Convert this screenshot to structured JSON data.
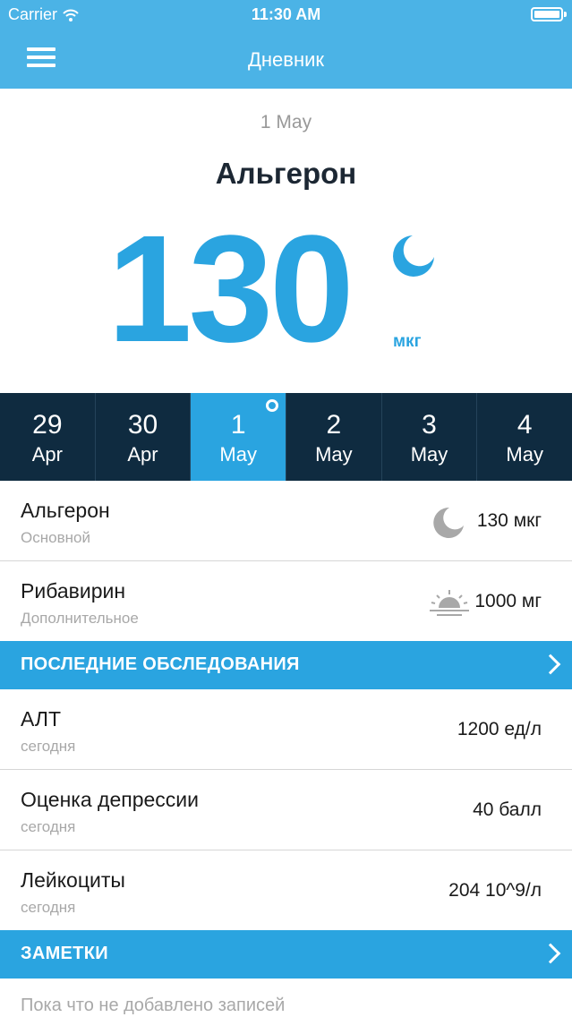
{
  "status": {
    "carrier": "Carrier",
    "time": "11:30 AM"
  },
  "header": {
    "title": "Дневник"
  },
  "summary": {
    "date": "1 May",
    "drug": "Альгерон",
    "dose": "130",
    "unit": "мкг"
  },
  "days": [
    {
      "num": "29",
      "mon": "Apr"
    },
    {
      "num": "30",
      "mon": "Apr"
    },
    {
      "num": "1",
      "mon": "May"
    },
    {
      "num": "2",
      "mon": "May"
    },
    {
      "num": "3",
      "mon": "May"
    },
    {
      "num": "4",
      "mon": "May"
    }
  ],
  "meds": [
    {
      "name": "Альгерон",
      "type": "Основной",
      "value": "130 мкг",
      "icon": "moon-icon"
    },
    {
      "name": "Рибавирин",
      "type": "Дополнительное",
      "value": "1000 мг",
      "icon": "sunrise-icon"
    }
  ],
  "exams": {
    "title": "ПОСЛЕДНИЕ ОБСЛЕДОВАНИЯ",
    "items": [
      {
        "name": "АЛТ",
        "when": "сегодня",
        "value": "1200 ед/л"
      },
      {
        "name": "Оценка депрессии",
        "when": "сегодня",
        "value": "40 балл"
      },
      {
        "name": "Лейкоциты",
        "when": "сегодня",
        "value": "204 10^9/л"
      }
    ]
  },
  "notes": {
    "title": "ЗАМЕТКИ",
    "empty": "Пока что не добавлено записей"
  },
  "colors": {
    "header": "#4bb3e6",
    "accent": "#2aa4e0",
    "days_bg": "#0f2b40"
  }
}
